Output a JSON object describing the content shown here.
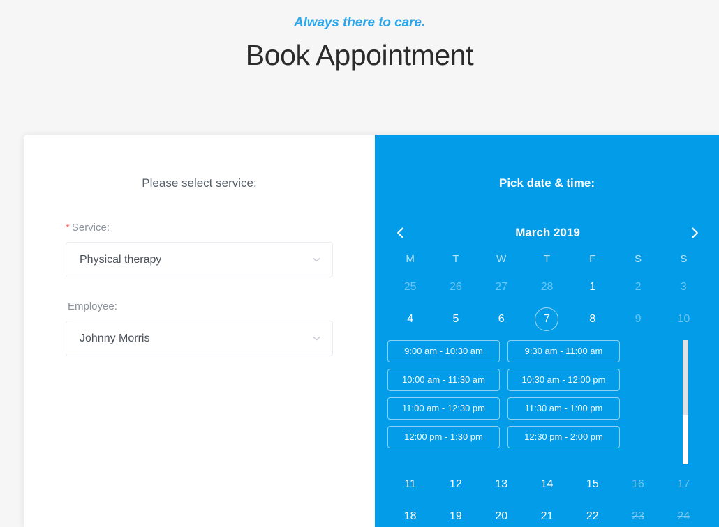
{
  "header": {
    "tagline": "Always there to care.",
    "title": "Book Appointment",
    "tagline_color": "#2ba6e8"
  },
  "service_panel": {
    "heading": "Please select service:",
    "accent_required_color": "#f16a6a",
    "fields": [
      {
        "label": "Service:",
        "required": true,
        "required_marker": "*",
        "value": "Physical therapy",
        "icon": "chevron-down-icon"
      },
      {
        "label": "Employee:",
        "required": false,
        "required_marker": "",
        "value": "Johnny Morris",
        "icon": "chevron-down-icon"
      }
    ]
  },
  "calendar_panel": {
    "heading": "Pick date & time:",
    "panel_color": "#039ce8",
    "prev_icon": "chevron-left-icon",
    "next_icon": "chevron-right-icon",
    "month_label": "March 2019",
    "weekdays": [
      "M",
      "T",
      "W",
      "T",
      "F",
      "S",
      "S"
    ],
    "weeks": [
      [
        {
          "day": "25",
          "state": "muted"
        },
        {
          "day": "26",
          "state": "muted"
        },
        {
          "day": "27",
          "state": "muted"
        },
        {
          "day": "28",
          "state": "muted"
        },
        {
          "day": "1",
          "state": "available"
        },
        {
          "day": "2",
          "state": "muted"
        },
        {
          "day": "3",
          "state": "muted"
        }
      ],
      [
        {
          "day": "4",
          "state": "available"
        },
        {
          "day": "5",
          "state": "available"
        },
        {
          "day": "6",
          "state": "available"
        },
        {
          "day": "7",
          "state": "selected"
        },
        {
          "day": "8",
          "state": "available"
        },
        {
          "day": "9",
          "state": "muted"
        },
        {
          "day": "10",
          "state": "muted-strike"
        }
      ],
      [
        {
          "day": "11",
          "state": "available"
        },
        {
          "day": "12",
          "state": "available"
        },
        {
          "day": "13",
          "state": "available"
        },
        {
          "day": "14",
          "state": "available"
        },
        {
          "day": "15",
          "state": "available"
        },
        {
          "day": "16",
          "state": "muted-strike"
        },
        {
          "day": "17",
          "state": "muted-strike"
        }
      ],
      [
        {
          "day": "18",
          "state": "available"
        },
        {
          "day": "19",
          "state": "available"
        },
        {
          "day": "20",
          "state": "available"
        },
        {
          "day": "21",
          "state": "available"
        },
        {
          "day": "22",
          "state": "available"
        },
        {
          "day": "23",
          "state": "muted-strike"
        },
        {
          "day": "24",
          "state": "muted-strike"
        }
      ]
    ],
    "time_slots": [
      "9:00 am - 10:30 am",
      "9:30 am - 11:00 am",
      "10:00 am - 11:30 am",
      "10:30 am - 12:00 pm",
      "11:00 am - 12:30 pm",
      "11:30 am - 1:00 pm",
      "12:00 pm - 1:30 pm",
      "12:30 pm - 2:00 pm"
    ]
  }
}
